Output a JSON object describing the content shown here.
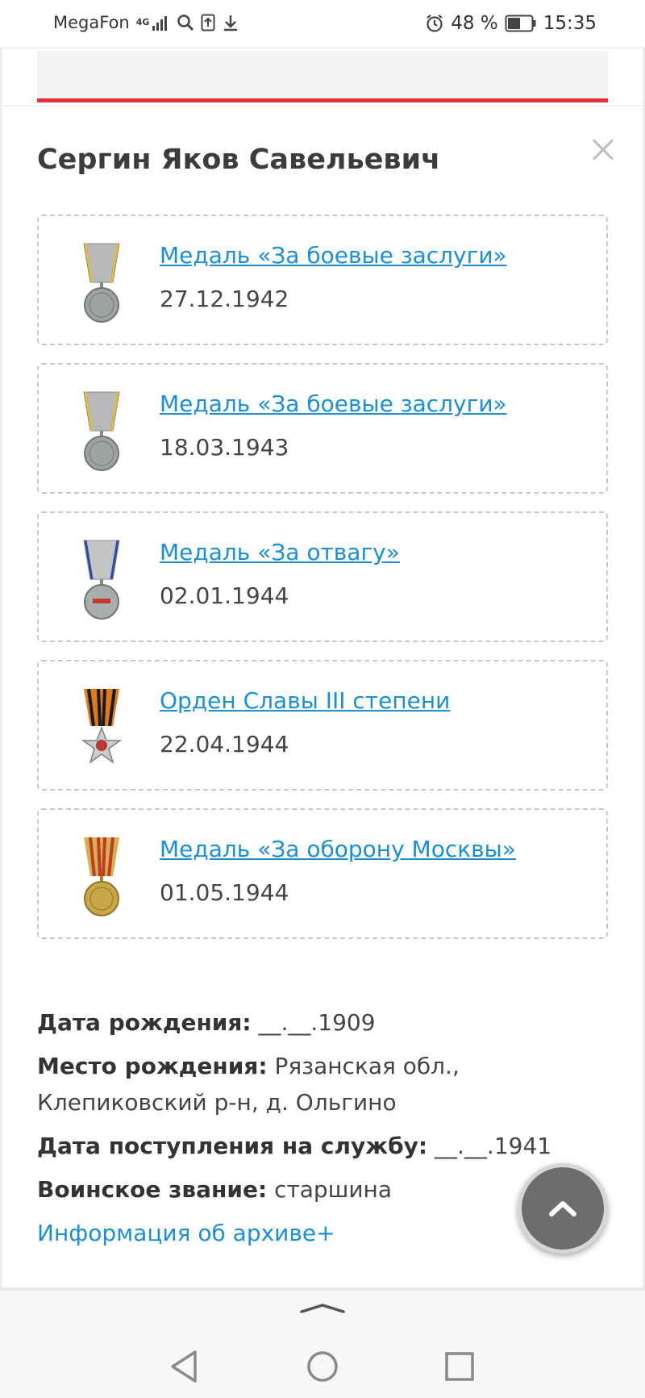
{
  "status_bar": {
    "carrier": "MegaFon",
    "network": "4G",
    "alarm_icon": "alarm-icon",
    "battery_percent": "48 %",
    "time": "15:35"
  },
  "person": {
    "name": "Сергин Яков Савельевич"
  },
  "awards": [
    {
      "title": "Медаль «За боевые заслуги»",
      "date": "27.12.1942",
      "icon": "medal-battle-merit-icon"
    },
    {
      "title": "Медаль «За боевые заслуги»",
      "date": "18.03.1943",
      "icon": "medal-battle-merit-icon"
    },
    {
      "title": "Медаль «За отвагу»",
      "date": "02.01.1944",
      "icon": "medal-courage-icon"
    },
    {
      "title": "Орден Славы III степени",
      "date": "22.04.1944",
      "icon": "order-glory-icon"
    },
    {
      "title": "Медаль «За оборону Москвы»",
      "date": "01.05.1944",
      "icon": "medal-defense-moscow-icon"
    }
  ],
  "info": {
    "birth_date_label": "Дата рождения:",
    "birth_date_value": "__.__.1909",
    "birth_place_label": "Место рождения:",
    "birth_place_value": "Рязанская обл., Клепиковский р-н, д. Ольгино",
    "service_start_label": "Дата поступления на службу:",
    "service_start_value": "__.__.1941",
    "rank_label": "Воинское звание:",
    "rank_value": "старшина",
    "archive_link": "Информация об архиве+"
  },
  "colors": {
    "accent_red": "#e33036",
    "link_blue": "#1a8fd6",
    "button_gray": "#6d6d6d"
  }
}
